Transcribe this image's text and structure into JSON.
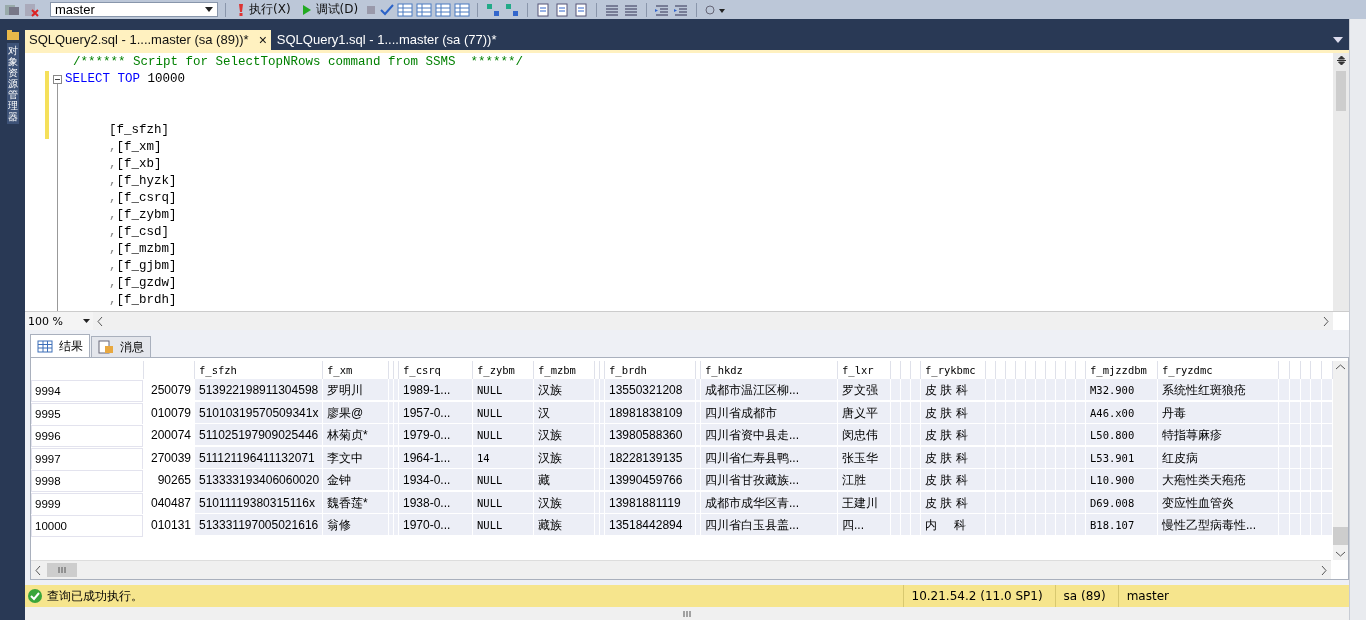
{
  "toolbar": {
    "database": "master",
    "execute": "执行(X)",
    "debug": "调试(D)"
  },
  "sidebar": {
    "title": "对象资源管理器"
  },
  "tabs": [
    {
      "label": "SQLQuery2.sql - 1....master (sa (89))*",
      "selected": true,
      "close": "×"
    },
    {
      "label": "SQLQuery1.sql - 1....master (sa (77))*",
      "selected": false
    }
  ],
  "editor": {
    "lines": [
      {
        "kind": "code",
        "changed": false,
        "segments": [
          {
            "text": "/****** Script for SelectTopNRows command from SSMS  ******/",
            "kind": "comment"
          }
        ]
      },
      {
        "kind": "code",
        "changed": true,
        "segments": [
          {
            "text": "SELECT",
            "kind": "keyword"
          },
          {
            "text": "TOP",
            "kind": "keyword"
          },
          {
            "text": "10000",
            "kind": "plain"
          }
        ]
      },
      {
        "kind": "blank",
        "changed": true
      },
      {
        "kind": "blank",
        "changed": true
      },
      {
        "kind": "code",
        "changed": true,
        "segments": [
          {
            "text": "[f_sfzh]",
            "kind": "plain"
          }
        ]
      },
      {
        "kind": "code",
        "changed": false,
        "segments": [
          {
            "text": ",",
            "kind": "punct"
          },
          {
            "text": "[f_xm]",
            "kind": "plain"
          }
        ]
      },
      {
        "kind": "code",
        "changed": false,
        "segments": [
          {
            "text": ",",
            "kind": "punct"
          },
          {
            "text": "[f_xb]",
            "kind": "plain"
          }
        ]
      },
      {
        "kind": "code",
        "changed": false,
        "segments": [
          {
            "text": ",",
            "kind": "punct"
          },
          {
            "text": "[f_hyzk]",
            "kind": "plain"
          }
        ]
      },
      {
        "kind": "code",
        "changed": false,
        "segments": [
          {
            "text": ",",
            "kind": "punct"
          },
          {
            "text": "[f_csrq]",
            "kind": "plain"
          }
        ]
      },
      {
        "kind": "code",
        "changed": false,
        "segments": [
          {
            "text": ",",
            "kind": "punct"
          },
          {
            "text": "[f_zybm]",
            "kind": "plain"
          }
        ]
      },
      {
        "kind": "code",
        "changed": false,
        "segments": [
          {
            "text": ",",
            "kind": "punct"
          },
          {
            "text": "[f_csd]",
            "kind": "plain"
          }
        ]
      },
      {
        "kind": "code",
        "changed": false,
        "segments": [
          {
            "text": ",",
            "kind": "punct"
          },
          {
            "text": "[f_mzbm]",
            "kind": "plain"
          }
        ]
      },
      {
        "kind": "code",
        "changed": false,
        "segments": [
          {
            "text": ",",
            "kind": "punct"
          },
          {
            "text": "[f_gjbm]",
            "kind": "plain"
          }
        ]
      },
      {
        "kind": "code",
        "changed": false,
        "segments": [
          {
            "text": ",",
            "kind": "punct"
          },
          {
            "text": "[f_gzdw]",
            "kind": "plain"
          }
        ]
      },
      {
        "kind": "code",
        "changed": false,
        "segments": [
          {
            "text": ",",
            "kind": "punct"
          },
          {
            "text": "[f_brdh]",
            "kind": "plain"
          }
        ]
      }
    ],
    "zoom": "100 %"
  },
  "result_tabs": [
    {
      "label": "结果",
      "selected": true
    },
    {
      "label": "消息",
      "selected": false
    }
  ],
  "table": {
    "columns": [
      "f_sfzh",
      "f_xm",
      "f_csrq",
      "f_zybm",
      "f_mzbm",
      "f_brdh",
      "f_hkdz",
      "f_lxr",
      "f_rykbmc",
      "f_mjzzdbm",
      "f_ryzdmc"
    ],
    "rows": [
      {
        "row_number": "9994",
        "column_2": "250079",
        "cells": [
          "513922198911304598",
          "罗明川",
          "1989-1...",
          "NULL",
          "汉族",
          "13550321208",
          "成都市温江区柳...",
          "罗文强",
          "皮 肤 科",
          "M32.900",
          "系统性红斑狼疮"
        ]
      },
      {
        "row_number": "9995",
        "column_2": "010079",
        "cells": [
          "51010319570509341x",
          "廖果@",
          "1957-0...",
          "NULL",
          "汉",
          "18981838109",
          "四川省成都市",
          "唐义平",
          "皮 肤 科",
          "A46.x00",
          "丹毒"
        ]
      },
      {
        "row_number": "9996",
        "column_2": "200074",
        "cells": [
          "511025197909025446",
          "林菊贞*",
          "1979-0...",
          "NULL",
          "汉族",
          "13980588360",
          "四川省资中县走...",
          "闵忠伟",
          "皮 肤 科",
          "L50.800",
          "特指荨麻疹"
        ]
      },
      {
        "row_number": "9997",
        "column_2": "270039",
        "cells": [
          "511121196411132071",
          "李文中",
          "1964-1...",
          "14",
          "汉族",
          "18228139135",
          "四川省仁寿县鸭...",
          "张玉华",
          "皮 肤 科",
          "L53.901",
          "红皮病"
        ]
      },
      {
        "row_number": "9998",
        "column_2": "90265",
        "cells": [
          "513333193406060020",
          "金钟",
          "1934-0...",
          "NULL",
          "藏",
          "13990459766",
          "四川省甘孜藏族...",
          "江胜",
          "皮 肤 科",
          "L10.900",
          "大疱性类天疱疮"
        ]
      },
      {
        "row_number": "9999",
        "column_2": "040487",
        "cells": [
          "51011119380315116x",
          "魏香莲*",
          "1938-0...",
          "NULL",
          "汉族",
          "13981881119",
          "成都市成华区青...",
          "王建川",
          "皮 肤 科",
          "D69.008",
          "变应性血管炎"
        ]
      },
      {
        "row_number": "10000",
        "column_2": "010131",
        "cells": [
          "513331197005021616",
          "翁修",
          "1970-0...",
          "NULL",
          "藏族",
          "13518442894",
          "四川省白玉县盖...",
          "四...",
          "内     科",
          "B18.107",
          "慢性乙型病毒性..."
        ]
      }
    ]
  },
  "status_bar": {
    "message": "查询已成功执行。",
    "server": "10.21.54.2 (11.0 SP1)",
    "user": "sa (89)",
    "database": "master"
  }
}
